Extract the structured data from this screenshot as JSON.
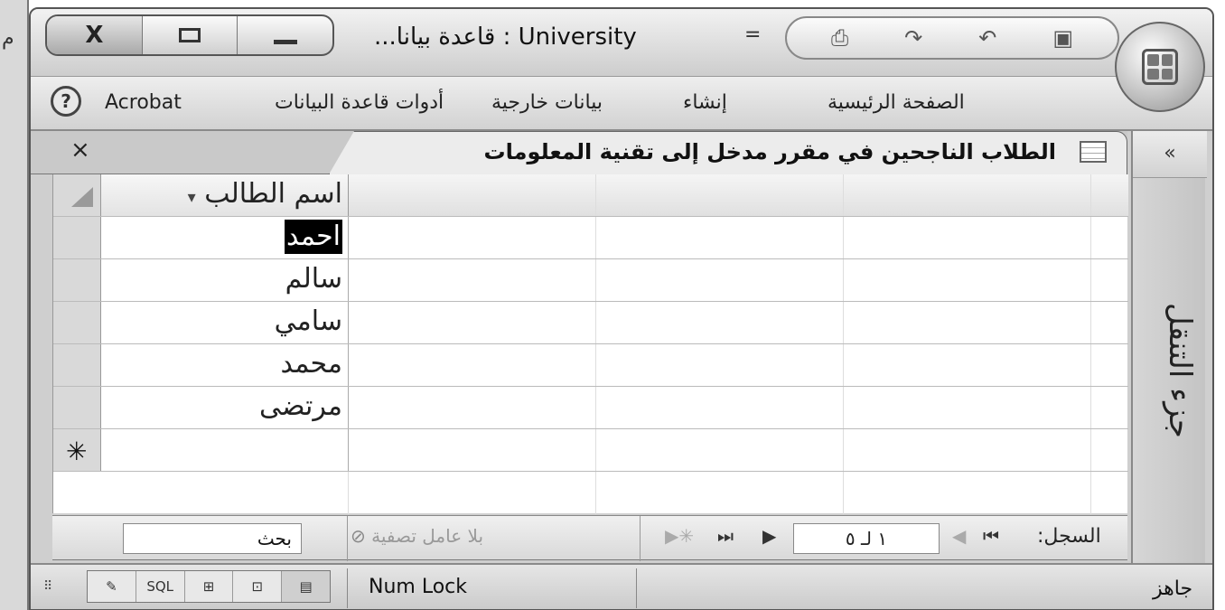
{
  "title_bar": {
    "title": "University : قاعدة بيانا...",
    "qat_dropdown": "=",
    "controls": {
      "close": "X"
    }
  },
  "icons": {
    "close": "close-icon",
    "restore": "restore-icon",
    "minimize": "minimize-icon",
    "save": "save-icon",
    "undo": "undo-icon",
    "redo": "redo-icon",
    "print": "print-icon",
    "office": "office-button-icon",
    "help": "help-icon"
  },
  "ribbon": {
    "help": "?",
    "tabs": [
      "Acrobat",
      "أدوات قاعدة البيانات",
      "بيانات خارجية",
      "إنشاء",
      "الصفحة الرئيسية"
    ]
  },
  "document": {
    "close": "×",
    "tab_title": "الطلاب الناجحين في مقرر مدخل إلى تقنية المعلومات"
  },
  "datasheet": {
    "column_header": "اسم الطالب",
    "sort_arrow": "▾",
    "rows": [
      "احمد",
      "سالم",
      "سامي",
      "محمد",
      "مرتضى"
    ],
    "new_record_marker": "✳"
  },
  "record_nav": {
    "label": "السجل:",
    "first": "⏮",
    "prev": "◀",
    "current": "١ لـ ٥",
    "next": "▶",
    "last": "⏭",
    "new": "▶✳",
    "filter": "بلا عامل تصفية",
    "search": "بحث"
  },
  "nav_pane": {
    "toggle": "«",
    "label": "جزء التنقل"
  },
  "status_bar": {
    "num_lock": "Num Lock",
    "ready": "جاهز",
    "views": [
      "✎",
      "SQL",
      "⊞",
      "⊡",
      "▤"
    ],
    "grip": "⠿"
  },
  "left_fragment": "م",
  "colors": {
    "selection_bg": "#000000",
    "selection_text": "#ffffff",
    "chrome": "#cfcfcf"
  }
}
